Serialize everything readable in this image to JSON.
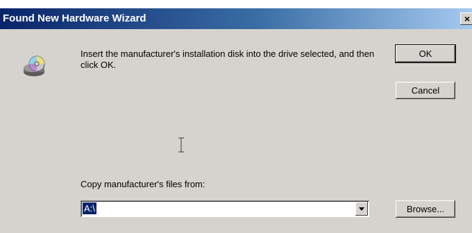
{
  "window": {
    "title": "Found New Hardware Wizard",
    "close_glyph": "×"
  },
  "message": {
    "text": "Insert the manufacturer's installation disk into the drive selected, and then click OK."
  },
  "buttons": {
    "ok_label": "OK",
    "cancel_label": "Cancel",
    "browse_label": "Browse..."
  },
  "copy_from": {
    "label": "Copy manufacturer's files from:",
    "value": "A:\\"
  },
  "icons": {
    "disk": "cd-disk-icon",
    "dropdown": "chevron-down-icon",
    "cursor": "text-cursor-icon"
  },
  "colors": {
    "titlebar_start": "#0a246a",
    "titlebar_end": "#a6caf0",
    "dialog_bg": "#d6d3ce",
    "selection_bg": "#0a246a"
  }
}
